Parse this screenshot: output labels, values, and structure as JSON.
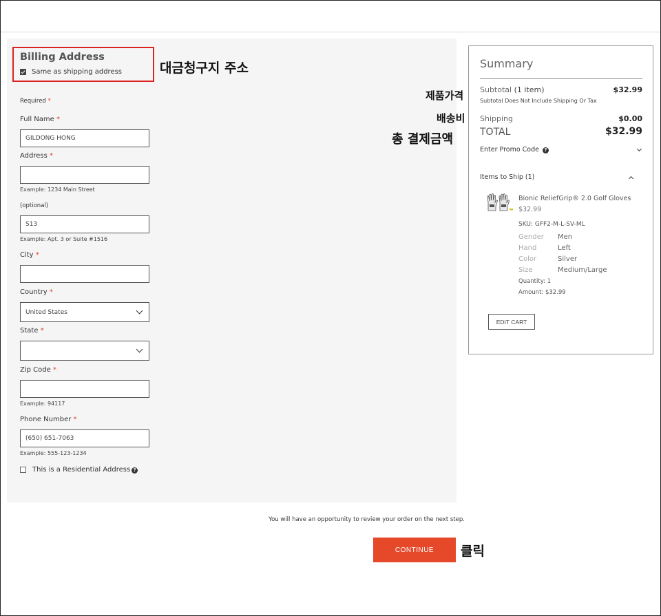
{
  "billing": {
    "title": "Billing Address",
    "same_as_shipping_label": "Same as shipping address",
    "same_as_shipping_checked": true,
    "required_label": "Required",
    "required_mark": "*"
  },
  "form": {
    "full_name": {
      "label": "Full Name",
      "value": "GILDONG HONG"
    },
    "address": {
      "label": "Address",
      "value": "",
      "hint": "Example: 1234 Main Street"
    },
    "address2": {
      "label": "(optional)",
      "value": "S13",
      "hint": "Example: Apt. 3 or Suite #1516"
    },
    "city": {
      "label": "City",
      "value": ""
    },
    "country": {
      "label": "Country",
      "value": "United States"
    },
    "state": {
      "label": "State",
      "value": ""
    },
    "zip": {
      "label": "Zip Code",
      "value": "",
      "hint": "Example: 94117"
    },
    "phone": {
      "label": "Phone Number",
      "value": "(650) 651-7063",
      "hint": "Example: 555-123-1234"
    },
    "residential": {
      "label": "This is a Residential Address",
      "checked": false
    }
  },
  "annotations": {
    "billing_address": "대금청구지 주소",
    "product_price": "제품가격",
    "shipping_fee": "배송비",
    "total_payment": "총 결제금액",
    "click": "클릭"
  },
  "summary": {
    "title": "Summary",
    "subtotal_label": "Subtotal",
    "subtotal_count": "(1 item)",
    "subtotal_value": "$32.99",
    "subtotal_note": "Subtotal Does Not Include Shipping Or Tax",
    "shipping_label": "Shipping",
    "shipping_value": "$0.00",
    "total_label": "TOTAL",
    "total_value": "$32.99",
    "promo_label": "Enter Promo Code",
    "items_label": "Items to Ship (1)",
    "item": {
      "name": "Bionic ReliefGrip® 2.0 Golf Gloves",
      "price": "$32.99",
      "sku": "SKU: GFF2-M-L-SV-ML",
      "attributes": [
        {
          "key": "Gender",
          "value": "Men"
        },
        {
          "key": "Hand",
          "value": "Left"
        },
        {
          "key": "Color",
          "value": "Silver"
        },
        {
          "key": "Size",
          "value": "Medium/Large"
        }
      ],
      "quantity": "Quantity: 1",
      "amount": "Amount: $32.99"
    },
    "edit_cart": "EDIT CART"
  },
  "footer": {
    "review_note": "You will have an opportunity to review your order on the next step.",
    "continue_label": "CONTINUE"
  },
  "colors": {
    "accent": "#e5492a",
    "highlight_border": "#dd2222",
    "required": "#e03c28",
    "panel_bg": "#f5f5f5"
  }
}
